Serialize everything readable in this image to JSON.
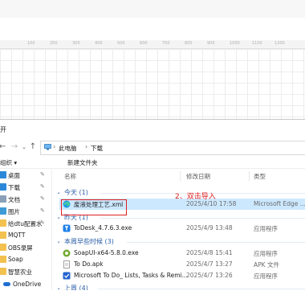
{
  "background": {
    "ruler_ticks": [
      "100",
      "200",
      "300",
      "400",
      "500",
      "600",
      "700",
      "800",
      "900",
      "1000",
      "1100",
      "1200"
    ]
  },
  "dialog": {
    "title": "开",
    "address": {
      "crumbs": [
        "此电脑",
        "下载"
      ]
    },
    "toolbar": {
      "organize": "组织 ▾",
      "new_folder": "新建文件夹"
    },
    "nav_items": [
      {
        "label": "桌面",
        "icon": "desktop-icon",
        "color": "#2b88d8",
        "pinned": true
      },
      {
        "label": "下载",
        "icon": "download-icon",
        "color": "#2b88d8",
        "pinned": true
      },
      {
        "label": "文档",
        "icon": "document-icon",
        "color": "#8aa0b8",
        "pinned": true
      },
      {
        "label": "图片",
        "icon": "picture-icon",
        "color": "#3f9ad6",
        "pinned": true
      },
      {
        "label": "给dtu配置水",
        "icon": "folder-icon",
        "color": "#f2c14e",
        "pinned": true
      },
      {
        "label": "MQTT",
        "icon": "folder-icon",
        "color": "#f2c14e",
        "pinned": false
      },
      {
        "label": "OBS录屏",
        "icon": "folder-icon",
        "color": "#f2c14e",
        "pinned": false
      },
      {
        "label": "Soap",
        "icon": "folder-icon",
        "color": "#f2c14e",
        "pinned": false
      },
      {
        "label": "智慧农业",
        "icon": "folder-icon",
        "color": "#f2c14e",
        "pinned": false
      },
      {
        "label": "OneDrive",
        "icon": "cloud-icon",
        "color": "#1e6fd0",
        "pinned": false
      }
    ],
    "columns": {
      "name": "名称",
      "date": "修改日期",
      "type": "类型"
    },
    "groups": [
      {
        "label": "今天 (1)",
        "files": [
          {
            "name": "废液处理工艺.xml",
            "date": "2025/4/10 17:58",
            "type": "Microsoft Edge ...",
            "icon": "edge-icon",
            "selected": true
          }
        ]
      },
      {
        "label": "昨天 (1)",
        "files": [
          {
            "name": "ToDesk_4.7.6.3.exe",
            "date": "2025/4/9 13:48",
            "type": "应用程序",
            "icon": "todesk-icon",
            "selected": false
          }
        ]
      },
      {
        "label": "本周早些时候 (3)",
        "files": [
          {
            "name": "SoapUI-x64-5.8.0.exe",
            "date": "2025/4/8 15:41",
            "type": "应用程序",
            "icon": "soapui-icon",
            "selected": false
          },
          {
            "name": "To Do.apk",
            "date": "2025/4/7 13:27",
            "type": "APK 文件",
            "icon": "apk-icon",
            "selected": false
          },
          {
            "name": "Microsoft To Do_ Lists, Tasks & Remi...",
            "date": "2025/4/7 13:26",
            "type": "应用程序",
            "icon": "todo-icon",
            "selected": false
          }
        ]
      },
      {
        "label": "上周 (4)",
        "files": []
      }
    ],
    "annotation": "2、双击导入"
  }
}
